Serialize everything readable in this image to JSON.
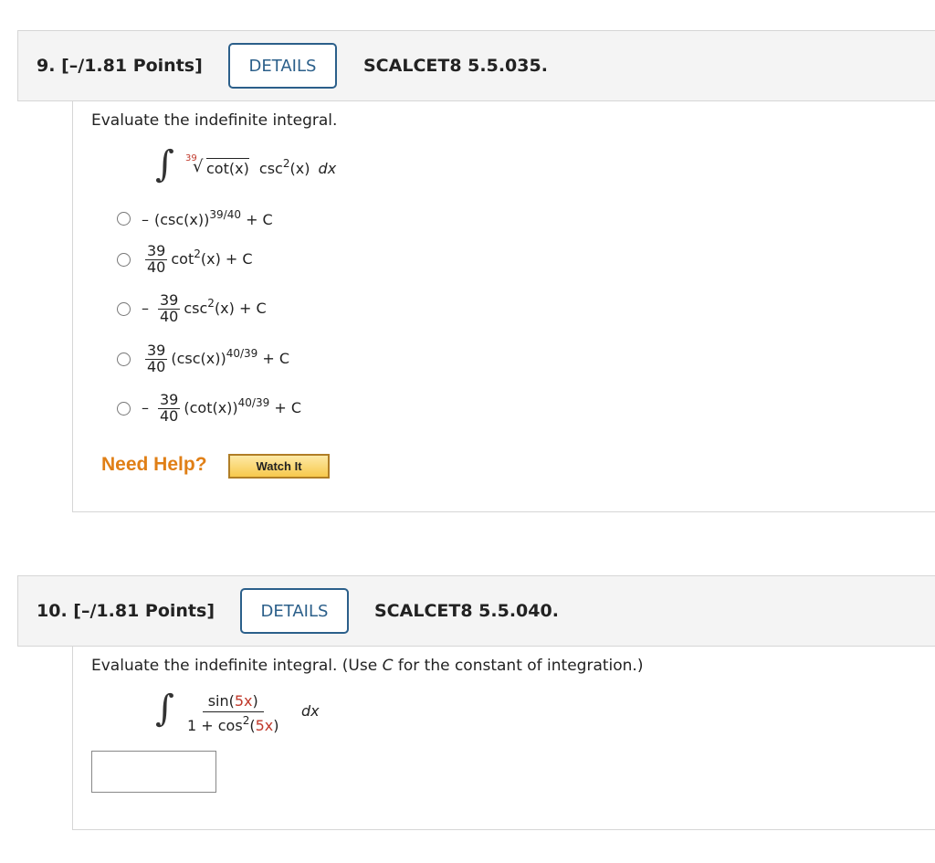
{
  "q9": {
    "number": "9.",
    "points": "[–/1.81 Points]",
    "details_label": "DETAILS",
    "code": "SCALCET8 5.5.035.",
    "prompt": "Evaluate the indefinite integral.",
    "integral": {
      "root_index": "39",
      "radicand": "cot(x)",
      "trig": "csc",
      "exp": "2",
      "arg": "(x)",
      "dx": "dx"
    },
    "choices": [
      {
        "sign": "–",
        "base": "(csc(x))",
        "exp": "39/40",
        "tail": "+ C"
      },
      {
        "sign": "",
        "num": "39",
        "den": "40",
        "base": "cot",
        "exp": "2",
        "arg": "(x)",
        "tail": "+ C"
      },
      {
        "sign": "–",
        "num": "39",
        "den": "40",
        "base": "csc",
        "exp": "2",
        "arg": "(x)",
        "tail": "+ C"
      },
      {
        "sign": "",
        "num": "39",
        "den": "40",
        "base": "(csc(x))",
        "exp": "40/39",
        "tail": "+ C"
      },
      {
        "sign": "–",
        "num": "39",
        "den": "40",
        "base": "(cot(x))",
        "exp": "40/39",
        "tail": "+ C"
      }
    ],
    "need_help": "Need Help?",
    "watch_label": "Watch It"
  },
  "q10": {
    "number": "10.",
    "points": "[–/1.81 Points]",
    "details_label": "DETAILS",
    "code": "SCALCET8 5.5.040.",
    "prompt_pre": "Evaluate the indefinite integral. (Use ",
    "prompt_c": "C",
    "prompt_post": " for the constant of integration.)",
    "integral": {
      "num_fn": "sin(",
      "inner": "5x",
      "close": ")",
      "den_pre": "1 + cos",
      "den_exp": "2",
      "den_open": "(",
      "den_close": ")",
      "dx": "dx"
    },
    "answer_value": ""
  },
  "colors": {
    "details_border": "#2b5f8a",
    "need_help": "#e07f16",
    "highlight_red": "#c0392b"
  }
}
